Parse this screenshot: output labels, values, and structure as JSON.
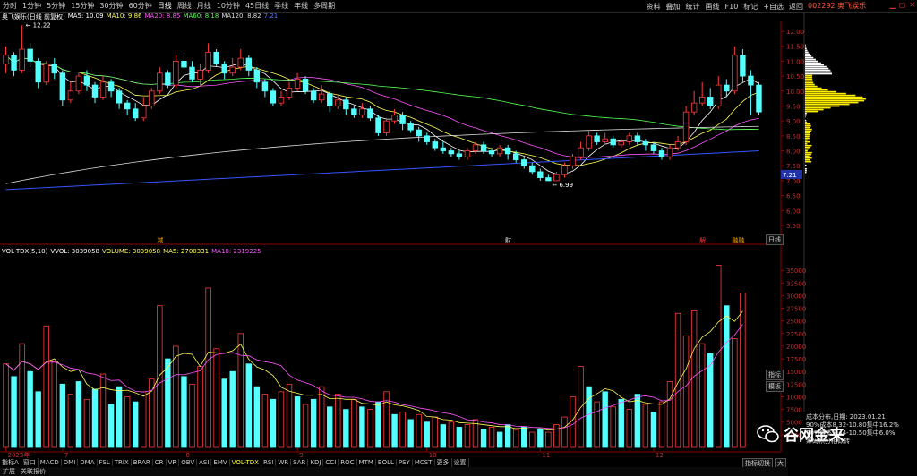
{
  "window": {
    "stock_code_name": "002292 奥飞娱乐",
    "period_tabs": [
      "分时",
      "1分钟",
      "5分钟",
      "15分钟",
      "30分钟",
      "60分钟",
      "日线",
      "周线",
      "月线",
      "10分钟",
      "45日线",
      "季线",
      "年线",
      "多周期"
    ],
    "toolbar": [
      "资料",
      "叠加",
      "统计",
      "画线",
      "F10",
      "标记",
      "+自选",
      "返回"
    ],
    "top_icons": [
      "minimize-icon",
      "restore-icon",
      "close-icon"
    ]
  },
  "ma_legend": {
    "title": "奥飞娱乐(日线 前复权)",
    "items": [
      {
        "label": "MA5: 10.09",
        "color": "#ffffff"
      },
      {
        "label": "MA10: 9.86",
        "color": "#ffff55"
      },
      {
        "label": "MA20: 8.85",
        "color": "#ff55ff"
      },
      {
        "label": "MA60: 8.18",
        "color": "#55ff55"
      },
      {
        "label": "MA120: 8.82",
        "color": "#dddddd"
      },
      {
        "label": "7.21",
        "color": "#5577ff"
      }
    ]
  },
  "price_labels": {
    "high": "12.22",
    "low": "6.99",
    "current": "7.21"
  },
  "event_markers": [
    {
      "text": "减",
      "color": "#ffaa00"
    },
    {
      "text": "财",
      "color": "#ffffff"
    },
    {
      "text": "解",
      "color": "#ff3333"
    },
    {
      "text": "融融",
      "color": "#ffaa00"
    }
  ],
  "vol_legend": {
    "title": "VOL-TDX(5,10)",
    "items": [
      {
        "label": "VVOL: 3039058",
        "color": "#ffffff"
      },
      {
        "label": "VOLUME: 3039058",
        "color": "#ffff55"
      },
      {
        "label": "MA5: 2700331",
        "color": "#ffff55"
      },
      {
        "label": "MA10: 2319225",
        "color": "#ff55ff"
      }
    ]
  },
  "x_labels": [
    "2023年",
    "7",
    "8",
    "9",
    "10",
    "11",
    "12"
  ],
  "bottom_tabs": [
    "指标A",
    "窗口",
    "MACD",
    "DMI",
    "DMA",
    "FSL",
    "TRIX",
    "BRAR",
    "CR",
    "VR",
    "OBV",
    "ASI",
    "EMV",
    "VOL-TDX",
    "RSI",
    "WR",
    "SAR",
    "KDJ",
    "CCI",
    "ROC",
    "MTM",
    "BOLL",
    "PSY",
    "MCST",
    "更多",
    "设置"
  ],
  "status_bar": [
    "扩展",
    "关联报价"
  ],
  "right_buttons": [
    "日线"
  ],
  "side_buttons": [
    "指标",
    "模板"
  ],
  "vol_buttons": [
    "指标切换",
    "大"
  ],
  "chip_info": {
    "title": "成本分布,日期: 2023.01.21",
    "line1": "90%成本8.32-10.80集中16.2%",
    "line2": "70%成本9.44-10.50集中6.0%",
    "footer": "筹码积分相似转"
  },
  "watermark": "谷网金来",
  "colors": {
    "up": "#ff3b3b",
    "down": "#54ffff",
    "bg": "#000000",
    "axis": "#8a0000"
  },
  "chart_data": {
    "type": "candlestick",
    "price_axis": {
      "ticks": [
        12.0,
        11.5,
        11.0,
        10.5,
        10.0,
        9.5,
        9.0,
        8.5,
        8.0,
        7.5,
        7.0,
        6.5,
        6.0,
        5.5
      ],
      "ylim": [
        5.2,
        12.3
      ]
    },
    "vol_axis": {
      "ticks": [
        35000,
        32500,
        30000,
        27500,
        25000,
        22500,
        20000,
        17500,
        15000,
        12500,
        10000,
        7500,
        5000,
        2500
      ],
      "ylim": [
        0,
        37500
      ]
    },
    "candles": [
      [
        10.9,
        11.2,
        11.5,
        10.6
      ],
      [
        11.2,
        10.7,
        11.3,
        10.5
      ],
      [
        10.7,
        11.4,
        12.2,
        10.6
      ],
      [
        11.4,
        11.0,
        11.6,
        10.8
      ],
      [
        11.0,
        10.3,
        11.1,
        10.1
      ],
      [
        10.3,
        10.9,
        11.0,
        10.2
      ],
      [
        10.9,
        10.6,
        11.1,
        10.4
      ],
      [
        10.6,
        9.7,
        10.7,
        9.5
      ],
      [
        9.7,
        10.0,
        10.3,
        9.6
      ],
      [
        10.0,
        10.5,
        10.6,
        9.9
      ],
      [
        10.5,
        10.2,
        10.7,
        10.0
      ],
      [
        10.2,
        9.8,
        10.3,
        9.6
      ],
      [
        9.8,
        10.3,
        10.5,
        9.7
      ],
      [
        10.3,
        10.0,
        10.4,
        9.8
      ],
      [
        10.0,
        9.6,
        10.1,
        9.4
      ],
      [
        9.6,
        9.4,
        9.7,
        9.2
      ],
      [
        9.4,
        9.1,
        9.6,
        9.0
      ],
      [
        9.1,
        9.5,
        9.8,
        9.0
      ],
      [
        9.5,
        10.0,
        10.1,
        9.4
      ],
      [
        10.0,
        10.6,
        10.8,
        9.9
      ],
      [
        10.6,
        10.2,
        10.7,
        10.1
      ],
      [
        10.2,
        11.0,
        11.2,
        10.1
      ],
      [
        11.0,
        10.8,
        11.3,
        10.6
      ],
      [
        10.8,
        10.4,
        11.0,
        10.3
      ],
      [
        10.4,
        10.7,
        10.9,
        10.2
      ],
      [
        10.7,
        11.3,
        11.6,
        10.6
      ],
      [
        11.3,
        10.9,
        11.4,
        10.8
      ],
      [
        10.9,
        10.6,
        11.0,
        10.4
      ],
      [
        10.6,
        10.8,
        11.1,
        10.5
      ],
      [
        10.8,
        11.1,
        11.4,
        10.7
      ],
      [
        11.1,
        10.7,
        11.2,
        10.5
      ],
      [
        10.7,
        10.3,
        10.8,
        10.1
      ],
      [
        10.3,
        10.0,
        10.4,
        9.8
      ],
      [
        10.0,
        9.6,
        10.1,
        9.5
      ],
      [
        9.6,
        9.8,
        10.0,
        9.5
      ],
      [
        9.8,
        10.1,
        10.3,
        9.7
      ],
      [
        10.1,
        10.4,
        10.6,
        10.0
      ],
      [
        10.4,
        10.0,
        10.5,
        9.9
      ],
      [
        10.0,
        9.7,
        10.1,
        9.6
      ],
      [
        9.7,
        9.9,
        10.2,
        9.6
      ],
      [
        9.9,
        9.5,
        10.0,
        9.3
      ],
      [
        9.5,
        9.7,
        9.9,
        9.4
      ],
      [
        9.7,
        9.4,
        9.8,
        9.2
      ],
      [
        9.4,
        9.2,
        9.5,
        9.1
      ],
      [
        9.2,
        9.4,
        9.6,
        9.1
      ],
      [
        9.4,
        9.1,
        9.5,
        9.0
      ],
      [
        9.1,
        8.6,
        9.2,
        8.5
      ],
      [
        8.6,
        9.0,
        9.1,
        8.5
      ],
      [
        9.0,
        9.2,
        9.4,
        8.9
      ],
      [
        9.2,
        8.9,
        9.3,
        8.7
      ],
      [
        8.9,
        8.7,
        9.0,
        8.6
      ],
      [
        8.7,
        8.5,
        8.8,
        8.3
      ],
      [
        8.5,
        8.3,
        8.6,
        8.2
      ],
      [
        8.3,
        8.1,
        8.4,
        8.0
      ],
      [
        8.1,
        8.0,
        8.3,
        7.9
      ],
      [
        8.0,
        7.9,
        8.1,
        7.8
      ],
      [
        7.9,
        7.8,
        8.0,
        7.7
      ],
      [
        7.8,
        8.0,
        8.1,
        7.7
      ],
      [
        8.0,
        8.2,
        8.3,
        7.9
      ],
      [
        8.2,
        8.0,
        8.3,
        7.9
      ],
      [
        8.0,
        7.9,
        8.1,
        7.8
      ],
      [
        7.9,
        8.1,
        8.2,
        7.8
      ],
      [
        8.1,
        7.9,
        8.2,
        7.7
      ],
      [
        7.9,
        7.7,
        8.0,
        7.6
      ],
      [
        7.7,
        7.5,
        7.8,
        7.4
      ],
      [
        7.5,
        7.3,
        7.6,
        7.2
      ],
      [
        7.3,
        7.1,
        7.4,
        7.0
      ],
      [
        7.1,
        7.0,
        7.2,
        6.99
      ],
      [
        7.0,
        7.2,
        7.3,
        6.99
      ],
      [
        7.2,
        7.5,
        7.6,
        7.1
      ],
      [
        7.5,
        7.8,
        7.9,
        7.4
      ],
      [
        7.8,
        8.1,
        8.3,
        7.7
      ],
      [
        8.1,
        8.5,
        8.7,
        8.0
      ],
      [
        8.5,
        8.3,
        8.6,
        8.2
      ],
      [
        8.3,
        8.4,
        8.6,
        8.2
      ],
      [
        8.4,
        8.2,
        8.5,
        8.1
      ],
      [
        8.2,
        8.3,
        8.4,
        8.1
      ],
      [
        8.3,
        8.5,
        8.6,
        8.2
      ],
      [
        8.5,
        8.3,
        8.6,
        8.2
      ],
      [
        8.3,
        8.2,
        8.4,
        8.0
      ],
      [
        8.2,
        8.0,
        8.3,
        7.9
      ],
      [
        8.0,
        7.8,
        8.1,
        7.7
      ],
      [
        7.8,
        8.1,
        8.2,
        7.7
      ],
      [
        8.1,
        8.3,
        8.5,
        8.0
      ],
      [
        8.3,
        9.3,
        9.5,
        8.2
      ],
      [
        9.3,
        9.6,
        10.0,
        9.2
      ],
      [
        9.6,
        9.8,
        10.3,
        9.5
      ],
      [
        9.8,
        9.5,
        10.1,
        9.4
      ],
      [
        9.5,
        10.2,
        10.5,
        9.4
      ],
      [
        10.2,
        10.0,
        10.4,
        9.8
      ],
      [
        10.0,
        11.2,
        11.5,
        9.9
      ],
      [
        11.2,
        10.5,
        11.4,
        10.3
      ],
      [
        10.5,
        10.2,
        10.7,
        9.2
      ],
      [
        10.2,
        9.3,
        10.3,
        9.2
      ]
    ],
    "volumes": [
      [
        16500,
        1
      ],
      [
        14000,
        0
      ],
      [
        20500,
        1
      ],
      [
        15000,
        0
      ],
      [
        11000,
        0
      ],
      [
        24000,
        1
      ],
      [
        17000,
        1
      ],
      [
        12500,
        0
      ],
      [
        10500,
        1
      ],
      [
        13000,
        0
      ],
      [
        9500,
        1
      ],
      [
        11500,
        0
      ],
      [
        14500,
        1
      ],
      [
        8500,
        0
      ],
      [
        12000,
        0
      ],
      [
        10000,
        1
      ],
      [
        9000,
        0
      ],
      [
        11000,
        1
      ],
      [
        13500,
        1
      ],
      [
        28000,
        1
      ],
      [
        17500,
        0
      ],
      [
        20000,
        1
      ],
      [
        14000,
        0
      ],
      [
        12500,
        1
      ],
      [
        16000,
        1
      ],
      [
        31500,
        1
      ],
      [
        19500,
        1
      ],
      [
        13500,
        0
      ],
      [
        15000,
        0
      ],
      [
        22500,
        1
      ],
      [
        16500,
        0
      ],
      [
        12000,
        0
      ],
      [
        10500,
        1
      ],
      [
        9500,
        0
      ],
      [
        11000,
        1
      ],
      [
        12500,
        1
      ],
      [
        10000,
        0
      ],
      [
        8500,
        1
      ],
      [
        9500,
        0
      ],
      [
        12000,
        1
      ],
      [
        8000,
        0
      ],
      [
        10500,
        1
      ],
      [
        7500,
        0
      ],
      [
        9500,
        1
      ],
      [
        8000,
        0
      ],
      [
        7500,
        1
      ],
      [
        9000,
        0
      ],
      [
        11000,
        1
      ],
      [
        6500,
        0
      ],
      [
        7000,
        1
      ],
      [
        5500,
        0
      ],
      [
        6500,
        1
      ],
      [
        5000,
        0
      ],
      [
        6000,
        1
      ],
      [
        4500,
        0
      ],
      [
        5000,
        1
      ],
      [
        4000,
        0
      ],
      [
        4500,
        1
      ],
      [
        5500,
        1
      ],
      [
        3500,
        0
      ],
      [
        4000,
        1
      ],
      [
        3000,
        0
      ],
      [
        4500,
        0
      ],
      [
        3500,
        1
      ],
      [
        4000,
        0
      ],
      [
        3000,
        1
      ],
      [
        3500,
        0
      ],
      [
        3000,
        1
      ],
      [
        4500,
        1
      ],
      [
        6000,
        1
      ],
      [
        10000,
        1
      ],
      [
        16000,
        1
      ],
      [
        12000,
        0
      ],
      [
        9000,
        1
      ],
      [
        11000,
        0
      ],
      [
        8000,
        1
      ],
      [
        9500,
        0
      ],
      [
        7500,
        1
      ],
      [
        10500,
        0
      ],
      [
        8500,
        1
      ],
      [
        7000,
        0
      ],
      [
        9000,
        1
      ],
      [
        13000,
        1
      ],
      [
        26500,
        1
      ],
      [
        22000,
        1
      ],
      [
        27000,
        1
      ],
      [
        20500,
        1
      ],
      [
        18500,
        0
      ],
      [
        36000,
        1
      ],
      [
        28000,
        0
      ],
      [
        21500,
        1
      ],
      [
        30500,
        1
      ]
    ]
  }
}
